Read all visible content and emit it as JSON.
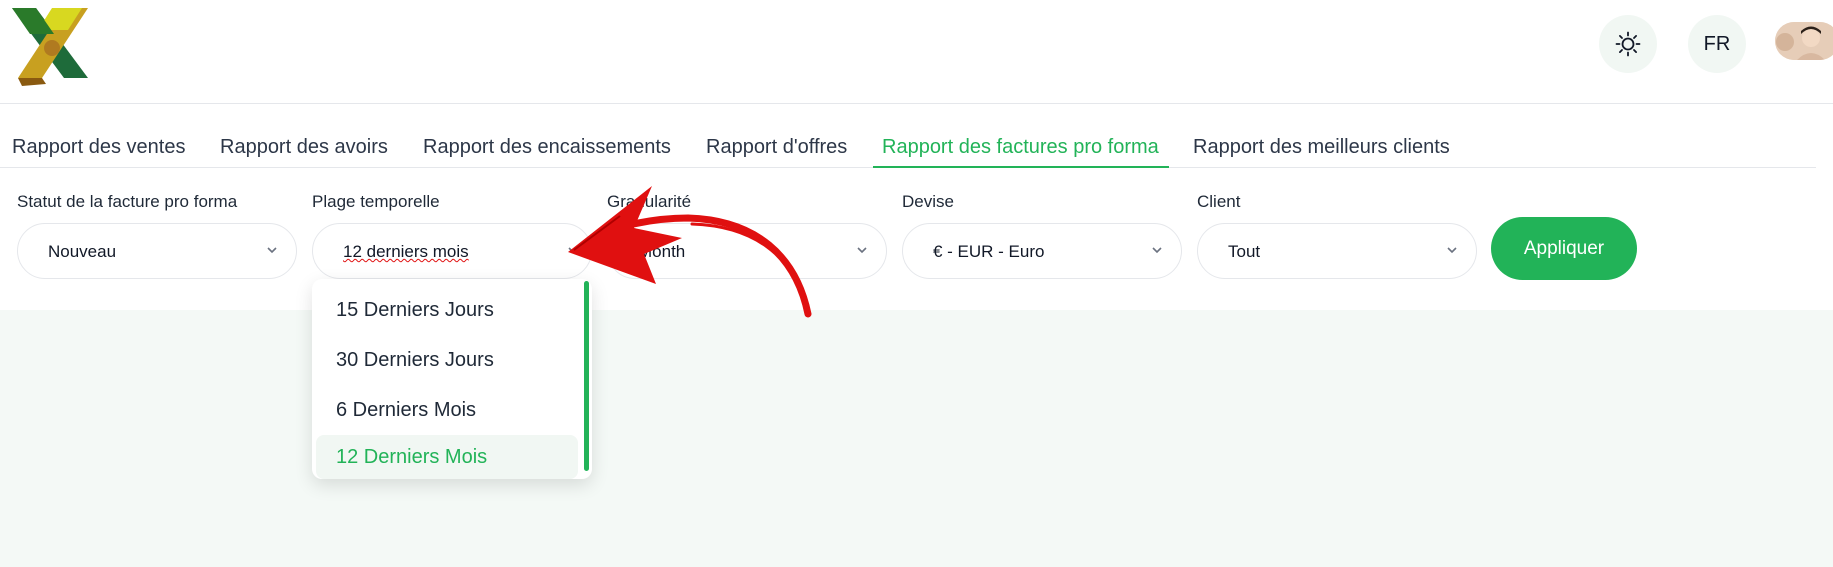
{
  "header": {
    "theme_icon": "sun-icon",
    "language": "FR",
    "avatar_icon": "user-avatar"
  },
  "tabs": [
    {
      "label": "Rapport des ventes"
    },
    {
      "label": "Rapport des avoirs"
    },
    {
      "label": "Rapport des encaissements"
    },
    {
      "label": "Rapport d'offres"
    },
    {
      "label": "Rapport des factures pro forma",
      "active": true
    },
    {
      "label": "Rapport des meilleurs clients"
    }
  ],
  "filters": {
    "status": {
      "label": "Statut de la facture pro forma",
      "value": "Nouveau"
    },
    "range": {
      "label": "Plage temporelle",
      "value": "12 derniers mois"
    },
    "granularity": {
      "label": "Granularité",
      "value": "Month"
    },
    "currency": {
      "label": "Devise",
      "value": "€ - EUR - Euro"
    },
    "client": {
      "label": "Client",
      "value": "Tout"
    },
    "apply": "Appliquer"
  },
  "range_dropdown": {
    "options": [
      "15 Derniers Jours",
      "30 Derniers Jours",
      "6 Derniers Mois",
      "12 Derniers Mois"
    ],
    "selected": "12 Derniers Mois"
  },
  "colors": {
    "accent": "#22b358",
    "annotation": "#e01010"
  }
}
